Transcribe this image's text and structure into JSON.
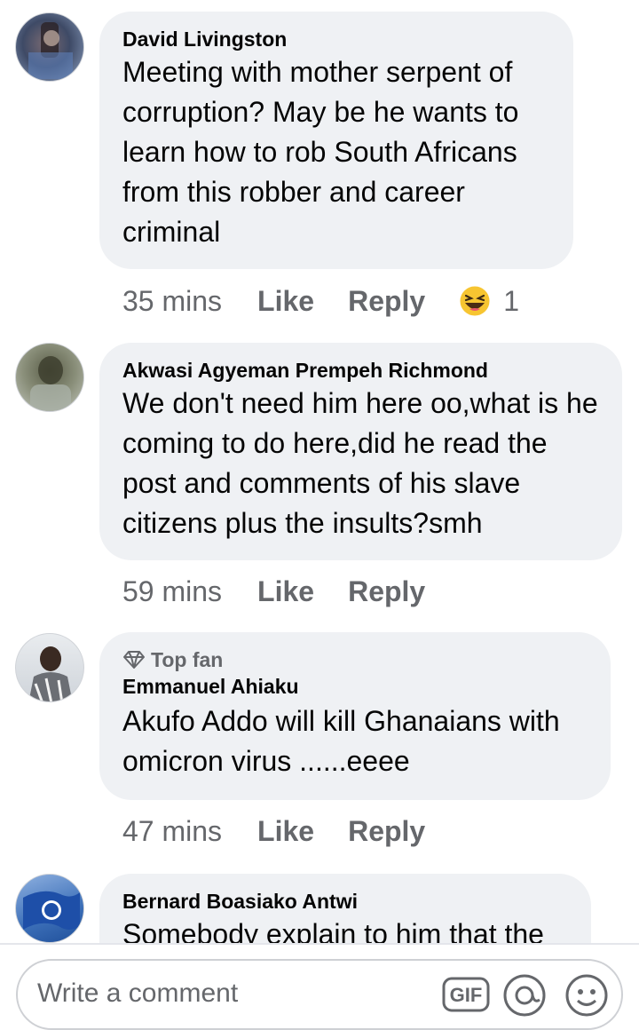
{
  "comments": [
    {
      "name": "David Livingston",
      "text": "Meeting with mother serpent of corruption?  May be he wants to learn how to rob South Africans from this robber and career criminal",
      "time": "35 mins",
      "like": "Like",
      "reply": "Reply",
      "reaction_count": "1"
    },
    {
      "name": "Akwasi Agyeman Prempeh Richmond",
      "text": "We don't need him here oo,what is he coming to do here,did he read the post and comments of his slave citizens plus the insults?smh",
      "time": "59 mins",
      "like": "Like",
      "reply": "Reply"
    },
    {
      "badge": "Top fan",
      "name": "Emmanuel Ahiaku",
      "text": "Akufo Addo will kill Ghanaians with omicron virus ......eeee",
      "time": "47 mins",
      "like": "Like",
      "reply": "Reply"
    },
    {
      "name": "Bernard Boasiako Antwi",
      "text": "Somebody explain to him that the"
    }
  ],
  "composer": {
    "placeholder": "Write a comment"
  }
}
